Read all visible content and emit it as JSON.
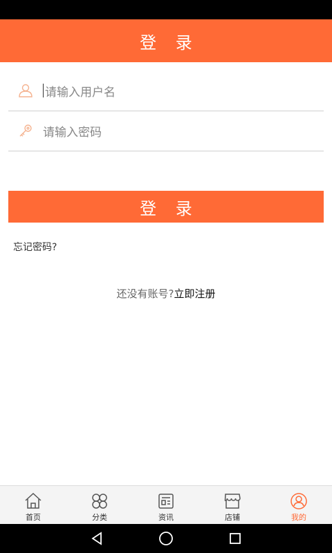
{
  "header": {
    "title": "登 录"
  },
  "form": {
    "username": {
      "placeholder": "请输入用户名",
      "icon": "user-icon"
    },
    "password": {
      "placeholder": "请输入密码",
      "icon": "key-icon"
    }
  },
  "login_button": {
    "label": "登 录"
  },
  "forgot_password": {
    "label": "忘记密码?"
  },
  "register": {
    "prompt": "还没有账号?",
    "link": "立即注册"
  },
  "tabs": [
    {
      "label": "首页",
      "icon": "home-icon",
      "active": false
    },
    {
      "label": "分类",
      "icon": "category-icon",
      "active": false
    },
    {
      "label": "资讯",
      "icon": "news-icon",
      "active": false
    },
    {
      "label": "店铺",
      "icon": "store-icon",
      "active": false
    },
    {
      "label": "我的",
      "icon": "profile-icon",
      "active": true
    }
  ],
  "colors": {
    "accent": "#ff6a36",
    "icon_inactive": "#555555",
    "field_icon": "#f5b28f"
  }
}
